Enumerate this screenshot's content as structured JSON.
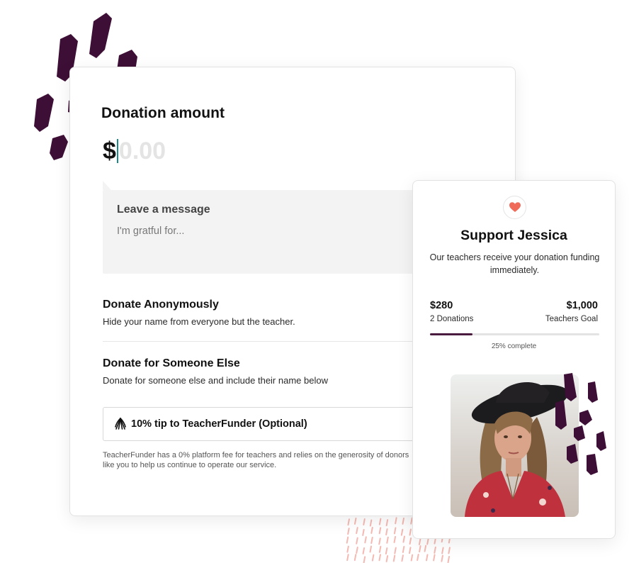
{
  "donation": {
    "title": "Donation amount",
    "currency": "$",
    "amount_placeholder": "0.00",
    "amount_value": "",
    "message_label": "Leave a message",
    "message_placeholder": "I'm gratful for...",
    "options": [
      {
        "title": "Donate Anonymously",
        "description": "Hide your name from everyone but the teacher."
      },
      {
        "title": "Donate for Someone Else",
        "description": "Donate for someone else and include their name below"
      }
    ],
    "tip_label": "10% tip to TeacherFunder (Optional)",
    "fee_note": "TeacherFunder has a 0% platform fee for teachers and relies on the generosity of donors like you to help us continue to operate our service."
  },
  "support": {
    "heart_icon": "heart-icon",
    "title": "Support Jessica",
    "description": "Our teachers receive your donation funding immediately.",
    "raised_amount": "$280",
    "donations_count": "2 Donations",
    "goal_amount": "$1,000",
    "goal_label": "Teachers Goal",
    "progress_fraction": 0.25,
    "progress_text": "25% complete"
  },
  "colors": {
    "accent_plum": "#4a1a3f",
    "heart": "#f06a5a",
    "caret": "#1a8a8a",
    "dash_pink": "#f4b9b2"
  }
}
